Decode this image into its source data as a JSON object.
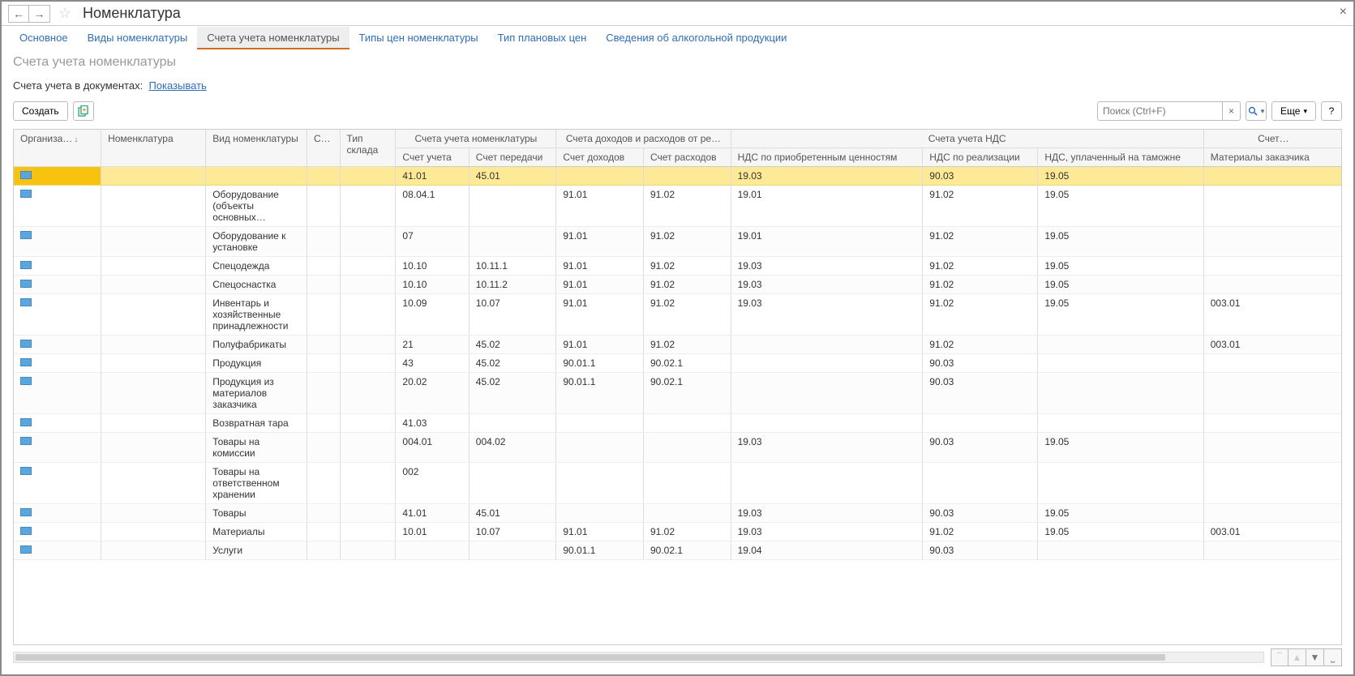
{
  "header": {
    "title": "Номенклатура"
  },
  "tabs": [
    {
      "label": "Основное",
      "active": false
    },
    {
      "label": "Виды номенклатуры",
      "active": false
    },
    {
      "label": "Счета учета номенклатуры",
      "active": true
    },
    {
      "label": "Типы цен номенклатуры",
      "active": false
    },
    {
      "label": "Тип плановых цен",
      "active": false
    },
    {
      "label": "Сведения об алкогольной продукции",
      "active": false
    }
  ],
  "subtitle": "Счета учета номенклатуры",
  "filter": {
    "prefix": "Счета учета в документах:",
    "link": "Показывать"
  },
  "toolbar": {
    "create": "Создать",
    "more": "Еще",
    "help": "?",
    "search_placeholder": "Поиск (Ctrl+F)"
  },
  "table": {
    "group_headers": {
      "org": "Организа…",
      "nom": "Номенклатура",
      "vid": "Вид номенклатуры",
      "s": "С…",
      "tip": "Тип склада",
      "accounts": "Счета учета номенклатуры",
      "income": "Счета доходов и расходов от ре…",
      "nds": "Счета учета НДС",
      "last": "Счет…"
    },
    "headers": {
      "schet_ucheta": "Счет учета",
      "schet_peredachi": "Счет передачи",
      "schet_dohodov": "Счет доходов",
      "schet_rashodov": "Счет расходов",
      "nds_priobr": "НДС по приобретенным ценностям",
      "nds_real": "НДС по реализации",
      "nds_tamozh": "НДС, уплаченный на таможне",
      "materialy": "Материалы заказчика"
    },
    "rows": [
      {
        "vid": "",
        "su": "41.01",
        "sp": "45.01",
        "sd": "",
        "sr": "",
        "n1": "19.03",
        "n2": "90.03",
        "n3": "19.05",
        "m": ""
      },
      {
        "vid": "Оборудование (объекты основных…",
        "su": "08.04.1",
        "sp": "",
        "sd": "91.01",
        "sr": "91.02",
        "n1": "19.01",
        "n2": "91.02",
        "n3": "19.05",
        "m": ""
      },
      {
        "vid": "Оборудование к установке",
        "su": "07",
        "sp": "",
        "sd": "91.01",
        "sr": "91.02",
        "n1": "19.01",
        "n2": "91.02",
        "n3": "19.05",
        "m": ""
      },
      {
        "vid": "Спецодежда",
        "su": "10.10",
        "sp": "10.11.1",
        "sd": "91.01",
        "sr": "91.02",
        "n1": "19.03",
        "n2": "91.02",
        "n3": "19.05",
        "m": ""
      },
      {
        "vid": "Спецоснастка",
        "su": "10.10",
        "sp": "10.11.2",
        "sd": "91.01",
        "sr": "91.02",
        "n1": "19.03",
        "n2": "91.02",
        "n3": "19.05",
        "m": ""
      },
      {
        "vid": "Инвентарь и хозяйственные принадлежности",
        "su": "10.09",
        "sp": "10.07",
        "sd": "91.01",
        "sr": "91.02",
        "n1": "19.03",
        "n2": "91.02",
        "n3": "19.05",
        "m": "003.01"
      },
      {
        "vid": "Полуфабрикаты",
        "su": "21",
        "sp": "45.02",
        "sd": "91.01",
        "sr": "91.02",
        "n1": "",
        "n2": "91.02",
        "n3": "",
        "m": "003.01"
      },
      {
        "vid": "Продукция",
        "su": "43",
        "sp": "45.02",
        "sd": "90.01.1",
        "sr": "90.02.1",
        "n1": "",
        "n2": "90.03",
        "n3": "",
        "m": ""
      },
      {
        "vid": "Продукция из материалов заказчика",
        "su": "20.02",
        "sp": "45.02",
        "sd": "90.01.1",
        "sr": "90.02.1",
        "n1": "",
        "n2": "90.03",
        "n3": "",
        "m": ""
      },
      {
        "vid": "Возвратная тара",
        "su": "41.03",
        "sp": "",
        "sd": "",
        "sr": "",
        "n1": "",
        "n2": "",
        "n3": "",
        "m": ""
      },
      {
        "vid": "Товары на комиссии",
        "su": "004.01",
        "sp": "004.02",
        "sd": "",
        "sr": "",
        "n1": "19.03",
        "n2": "90.03",
        "n3": "19.05",
        "m": ""
      },
      {
        "vid": "Товары на ответственном хранении",
        "su": "002",
        "sp": "",
        "sd": "",
        "sr": "",
        "n1": "",
        "n2": "",
        "n3": "",
        "m": ""
      },
      {
        "vid": "Товары",
        "su": "41.01",
        "sp": "45.01",
        "sd": "",
        "sr": "",
        "n1": "19.03",
        "n2": "90.03",
        "n3": "19.05",
        "m": ""
      },
      {
        "vid": "Материалы",
        "su": "10.01",
        "sp": "10.07",
        "sd": "91.01",
        "sr": "91.02",
        "n1": "19.03",
        "n2": "91.02",
        "n3": "19.05",
        "m": "003.01"
      },
      {
        "vid": "Услуги",
        "su": "",
        "sp": "",
        "sd": "90.01.1",
        "sr": "90.02.1",
        "n1": "19.04",
        "n2": "90.03",
        "n3": "",
        "m": ""
      }
    ]
  }
}
